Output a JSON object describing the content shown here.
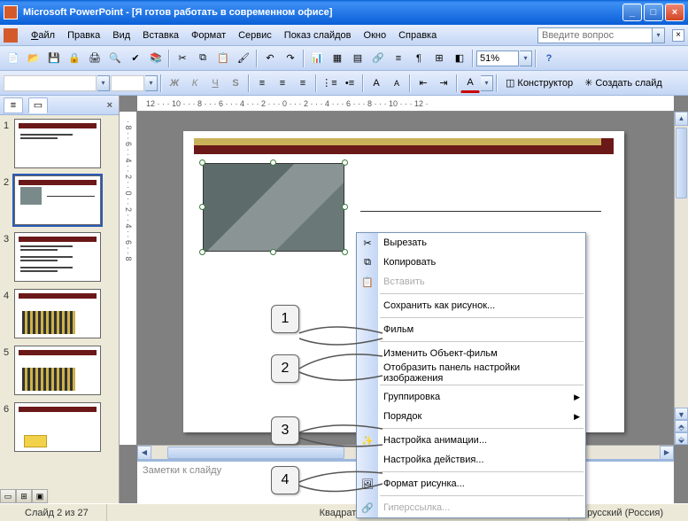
{
  "app": {
    "name": "Microsoft PowerPoint",
    "doc_title": "[Я готов работать в современном офисе]"
  },
  "menu": {
    "file": "Файл",
    "edit": "Правка",
    "view": "Вид",
    "insert": "Вставка",
    "format": "Формат",
    "tools": "Сервис",
    "slideshow": "Показ слайдов",
    "window": "Окно",
    "help": "Справка",
    "ask_placeholder": "Введите вопрос"
  },
  "toolbar": {
    "zoom": "51%",
    "designer": "Конструктор",
    "new_slide": "Создать слайд"
  },
  "ruler_h": "12 · · · 10 · · · 8 · · · 6 · · · 4 · · · 2 · · · 0 · · · 2 · · · 4 · · · 6 · · · 8 · · · 10 · · · 12 ·",
  "ruler_v": "· 8 · · 6 · · 4 · · 2 · · 0 · · 2 · · 4 · · 6 · · 8",
  "slides": {
    "count": 6,
    "nums": [
      "1",
      "2",
      "3",
      "4",
      "5",
      "6"
    ]
  },
  "context_menu": {
    "cut": "Вырезать",
    "copy": "Копировать",
    "paste": "Вставить",
    "save_as_picture": "Сохранить как рисунок...",
    "movie": "Фильм",
    "edit_movie_object": "Изменить Объект-фильм",
    "show_picture_toolbar": "Отобразить панель настройки изображения",
    "grouping": "Группировка",
    "order": "Порядок",
    "custom_animation": "Настройка анимации...",
    "action_settings": "Настройка действия...",
    "format_picture": "Формат рисунка...",
    "hyperlink": "Гиперссылка..."
  },
  "callouts": {
    "c1": "1",
    "c2": "2",
    "c3": "3",
    "c4": "4"
  },
  "notes_placeholder": "Заметки к слайду",
  "status": {
    "slide": "Слайд 2 из 27",
    "shape": "Квадрат",
    "lang": "русский (Россия)"
  },
  "winbtns": {
    "min": "_",
    "max": "□",
    "close": "×"
  }
}
